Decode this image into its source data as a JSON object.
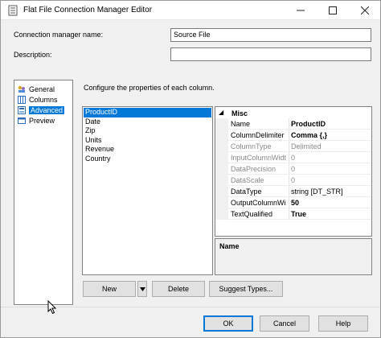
{
  "window": {
    "title": "Flat File Connection Manager Editor"
  },
  "form": {
    "name_label": "Connection manager name:",
    "name_value": "Source File",
    "description_label": "Description:",
    "description_value": ""
  },
  "nav": {
    "items": [
      {
        "label": "General",
        "icon": "general-icon"
      },
      {
        "label": "Columns",
        "icon": "columns-icon"
      },
      {
        "label": "Advanced",
        "icon": "advanced-icon",
        "selected": true
      },
      {
        "label": "Preview",
        "icon": "preview-icon"
      }
    ]
  },
  "advanced": {
    "hint": "Configure the properties of each column.",
    "columns": [
      "ProductID",
      "Date",
      "Zip",
      "Units",
      "Revenue",
      "Country"
    ],
    "selected_column": "ProductID",
    "category": "Misc",
    "properties": [
      {
        "name": "Name",
        "value": "ProductID",
        "bold": true,
        "readonly": false
      },
      {
        "name": "ColumnDelimiter",
        "value": "Comma {,}",
        "bold": true,
        "readonly": false
      },
      {
        "name": "ColumnType",
        "value": "Delimited",
        "bold": false,
        "readonly": true
      },
      {
        "name": "InputColumnWidt",
        "value": "0",
        "bold": false,
        "readonly": true
      },
      {
        "name": "DataPrecision",
        "value": "0",
        "bold": false,
        "readonly": true
      },
      {
        "name": "DataScale",
        "value": "0",
        "bold": false,
        "readonly": true
      },
      {
        "name": "DataType",
        "value": "string [DT_STR]",
        "bold": false,
        "readonly": false
      },
      {
        "name": "OutputColumnWi",
        "value": "50",
        "bold": true,
        "readonly": false
      },
      {
        "name": "TextQualified",
        "value": "True",
        "bold": true,
        "readonly": false
      }
    ],
    "description_title": "Name",
    "buttons": {
      "new": "New",
      "delete": "Delete",
      "suggest": "Suggest Types..."
    }
  },
  "footer": {
    "ok": "OK",
    "cancel": "Cancel",
    "help": "Help"
  },
  "colors": {
    "selection": "#0078d7",
    "window_bg": "#f0f0f0",
    "border": "#828282"
  }
}
